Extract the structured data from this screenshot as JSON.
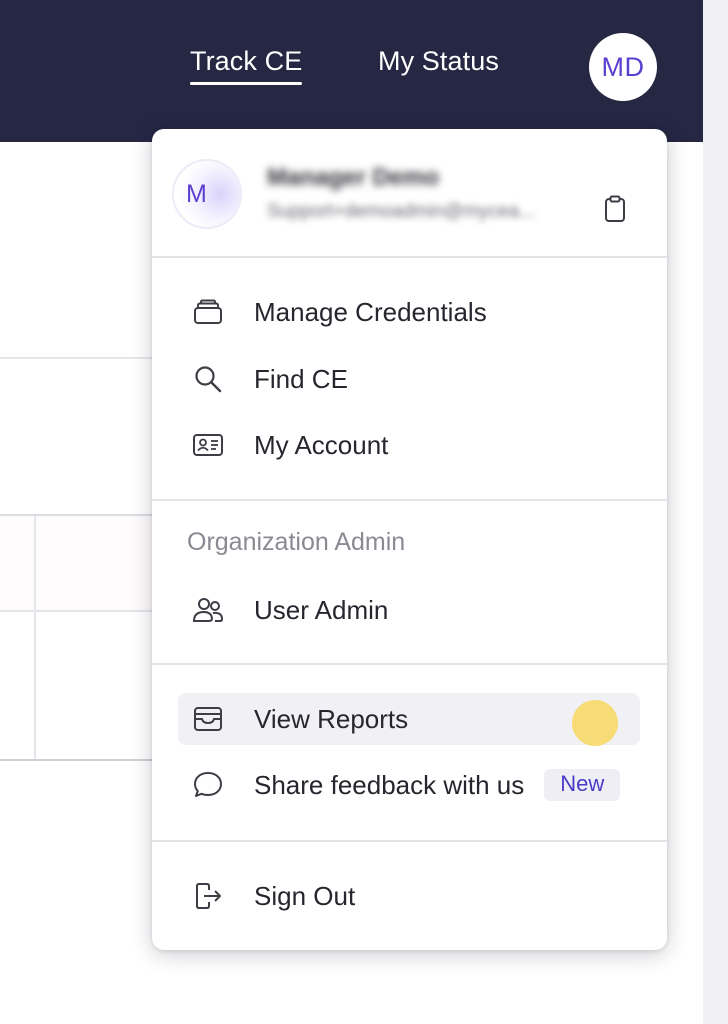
{
  "nav": {
    "track_ce": "Track CE",
    "my_status": "My Status",
    "avatar_initials": "MD"
  },
  "profile": {
    "avatar_initials": "M",
    "name": "Manager Demo",
    "email": "Support+demoadmin@mycea..."
  },
  "menu": {
    "items_top": [
      {
        "label": "Manage Credentials",
        "icon": "credentials-stack-icon"
      },
      {
        "label": "Find CE",
        "icon": "search-icon"
      },
      {
        "label": "My Account",
        "icon": "id-card-icon"
      }
    ],
    "org_section_title": "Organization Admin",
    "user_admin": {
      "label": "User Admin",
      "icon": "users-icon"
    },
    "view_reports": {
      "label": "View Reports",
      "icon": "reports-tray-icon"
    },
    "feedback": {
      "label": "Share feedback with us",
      "icon": "chat-bubble-icon",
      "badge": "New"
    },
    "sign_out": {
      "label": "Sign Out",
      "icon": "sign-out-icon"
    }
  },
  "colors": {
    "nav_bg": "#262743",
    "accent": "#5b3fd0",
    "hover_bg": "#f0f0f5",
    "cursor_highlight": "#f7da6e"
  }
}
